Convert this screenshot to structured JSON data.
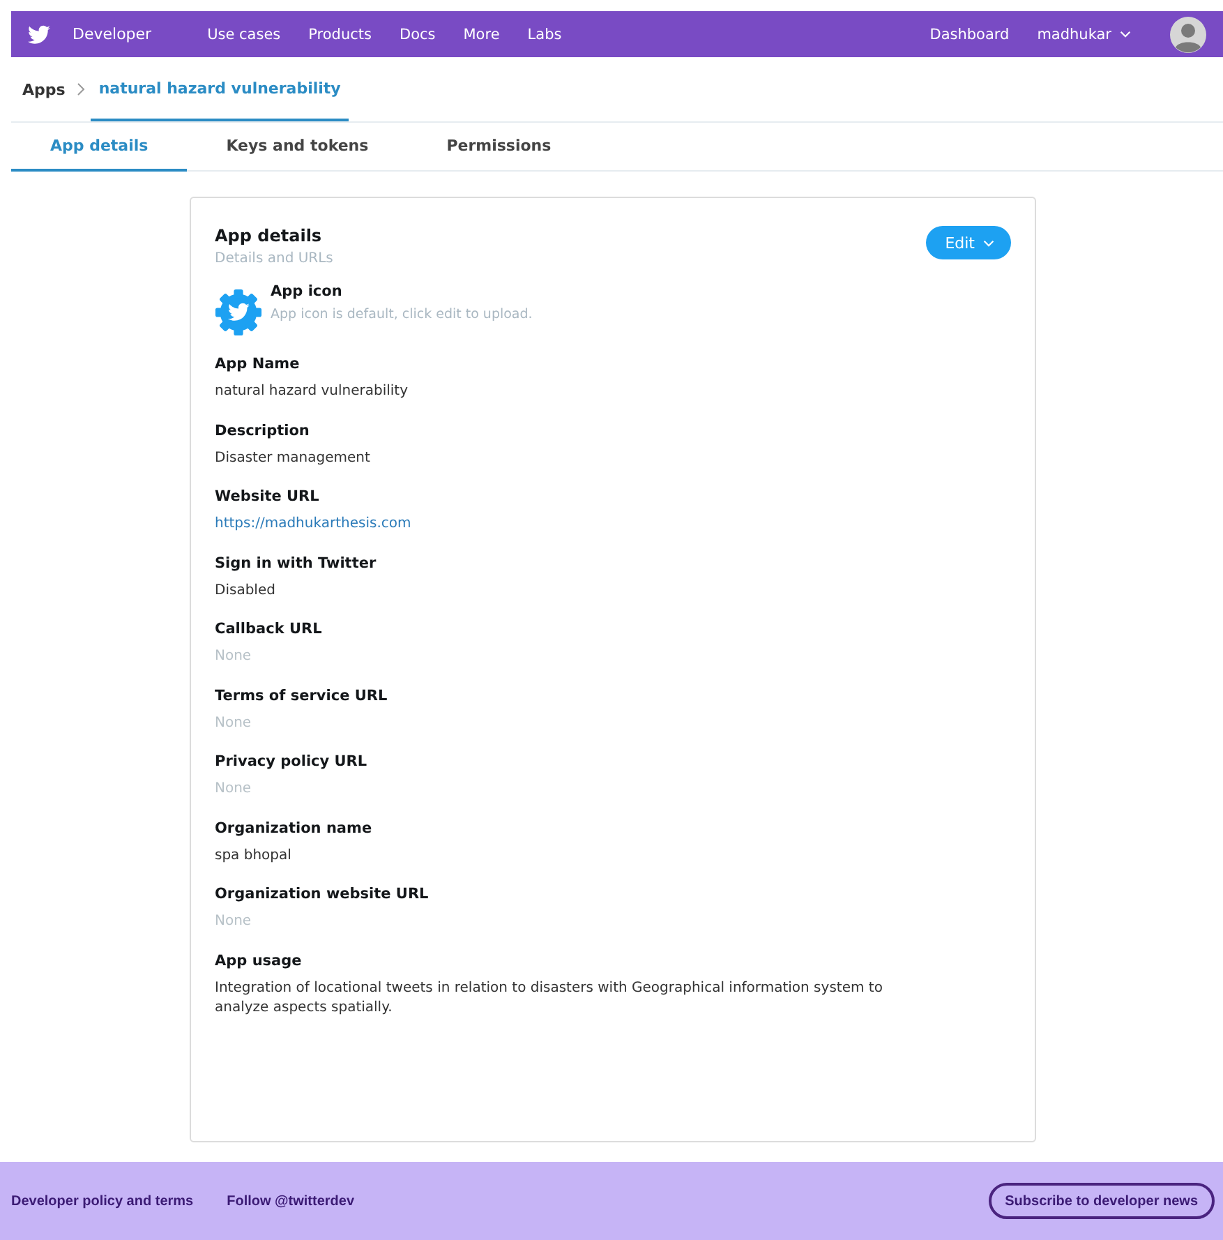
{
  "nav": {
    "brand": "Developer",
    "links": [
      "Use cases",
      "Products",
      "Docs",
      "More",
      "Labs"
    ],
    "dashboard": "Dashboard",
    "user": "madhukar"
  },
  "breadcrumb": {
    "root": "Apps",
    "current": "natural hazard vulnerability"
  },
  "tabs": [
    {
      "label": "App details",
      "selected": true
    },
    {
      "label": "Keys and tokens",
      "selected": false
    },
    {
      "label": "Permissions",
      "selected": false
    }
  ],
  "card": {
    "title": "App details",
    "subtitle": "Details and URLs",
    "edit": "Edit",
    "icon_label": "App icon",
    "icon_hint": "App icon is default, click edit to upload.",
    "fields": [
      {
        "label": "App Name",
        "value": "natural hazard vulnerability",
        "kind": "text"
      },
      {
        "label": "Description",
        "value": "Disaster management",
        "kind": "text"
      },
      {
        "label": "Website URL",
        "value": "https://madhukarthesis.com",
        "kind": "link"
      },
      {
        "label": "Sign in with Twitter",
        "value": "Disabled",
        "kind": "text"
      },
      {
        "label": "Callback URL",
        "value": "None",
        "kind": "none"
      },
      {
        "label": "Terms of service URL",
        "value": "None",
        "kind": "none"
      },
      {
        "label": "Privacy policy URL",
        "value": "None",
        "kind": "none"
      },
      {
        "label": "Organization name",
        "value": "spa bhopal",
        "kind": "text"
      },
      {
        "label": "Organization website URL",
        "value": "None",
        "kind": "none"
      },
      {
        "label": "App usage",
        "value": " Integration of locational tweets in relation to disasters with Geographical information system to analyze aspects spatially.",
        "kind": "text"
      }
    ]
  },
  "footer": {
    "links": [
      "Developer policy and terms",
      "Follow @twitterdev"
    ],
    "subscribe": "Subscribe to developer news"
  }
}
